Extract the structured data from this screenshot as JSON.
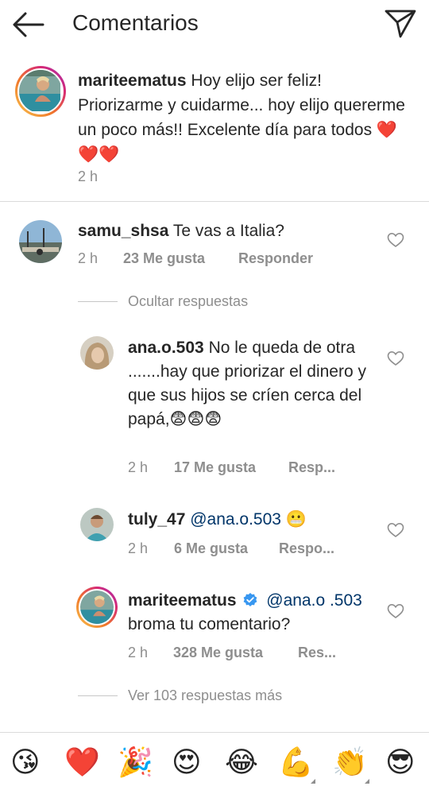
{
  "header": {
    "title": "Comentarios",
    "back_icon": "arrow-left-icon",
    "send_icon": "paper-plane-icon"
  },
  "caption": {
    "username": "mariteematus",
    "text": "Hoy elijo ser feliz! Priorizarme y cuidarme... hoy elijo quererme un poco más!! Excelente día para todos ❤️❤️❤️",
    "time": "2 h"
  },
  "comments": [
    {
      "username": "samu_shsa",
      "text": "Te vas a Italia?",
      "time": "2 h",
      "likes": "23 Me gusta",
      "reply": "Responder"
    }
  ],
  "hide_replies": "Ocultar respuestas",
  "replies": [
    {
      "username": "ana.o.503",
      "text": "No le queda de otra .......hay que priorizar el dinero y que sus hijos se críen cerca del papá,😨😨😨",
      "time": "2 h",
      "likes": "17 Me gusta",
      "reply": "Resp..."
    },
    {
      "username": "tuly_47",
      "mention": "@ana.o.503",
      "text": "😬",
      "time": "2 h",
      "likes": "6 Me gusta",
      "reply": "Respo..."
    },
    {
      "username": "mariteematus",
      "mention": "@ana.o .503",
      "text": "broma tu comentario?",
      "time": "2 h",
      "likes": "328 Me gusta",
      "reply": "Res..."
    }
  ],
  "more_replies": "Ver 103 respuestas más",
  "emoji_bar": [
    "😘",
    "❤️",
    "🎉",
    "😍",
    "😂",
    "💪",
    "👏",
    "😎"
  ],
  "colors": {
    "text": "#262626",
    "secondary": "#8e8e8e",
    "heart": "#ed4956",
    "mention": "#003569",
    "verified": "#3897f0",
    "divider": "#dbdbdb"
  }
}
